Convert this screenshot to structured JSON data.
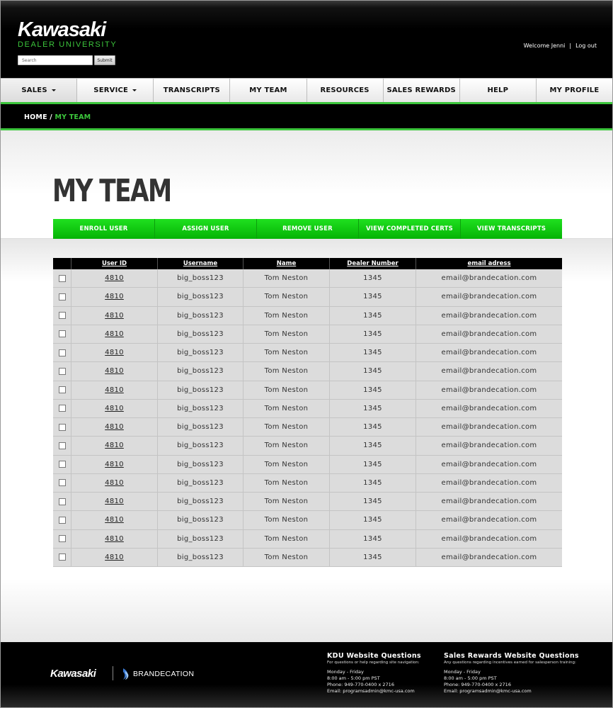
{
  "header": {
    "logo_main": "Kawasaki",
    "logo_sub": "DEALER UNIVERSITY",
    "search_placeholder": "Search",
    "submit_label": "Submit",
    "welcome": "Welcome Jenni",
    "separator": "|",
    "logout": "Log out"
  },
  "nav": {
    "items": [
      {
        "label": "SALES",
        "has_caret": true
      },
      {
        "label": "SERVICE",
        "has_caret": true
      },
      {
        "label": "TRANSCRIPTS"
      },
      {
        "label": "MY TEAM"
      },
      {
        "label": "RESOURCES"
      },
      {
        "label": "SALES REWARDS"
      },
      {
        "label": "HELP"
      },
      {
        "label": "MY PROFILE"
      }
    ]
  },
  "breadcrumb": {
    "home": "HOME",
    "separator": " / ",
    "current": "MY TEAM"
  },
  "page": {
    "title": "MY TEAM"
  },
  "actions": [
    "ENROLL USER",
    "ASSIGN USER",
    "REMOVE USER",
    "VIEW COMPLETED CERTS",
    "VIEW TRANSCRIPTS"
  ],
  "table": {
    "columns": [
      "User ID",
      "Username",
      "Name",
      "Dealer Number",
      "email adress"
    ],
    "rows": [
      {
        "user_id": "4810",
        "username": "big_boss123",
        "name": "Tom Neston",
        "dealer": "1345",
        "email": "email@brandecation.com"
      },
      {
        "user_id": "4810",
        "username": "big_boss123",
        "name": "Tom Neston",
        "dealer": "1345",
        "email": "email@brandecation.com"
      },
      {
        "user_id": "4810",
        "username": "big_boss123",
        "name": "Tom Neston",
        "dealer": "1345",
        "email": "email@brandecation.com"
      },
      {
        "user_id": "4810",
        "username": "big_boss123",
        "name": "Tom Neston",
        "dealer": "1345",
        "email": "email@brandecation.com"
      },
      {
        "user_id": "4810",
        "username": "big_boss123",
        "name": "Tom Neston",
        "dealer": "1345",
        "email": "email@brandecation.com"
      },
      {
        "user_id": "4810",
        "username": "big_boss123",
        "name": "Tom Neston",
        "dealer": "1345",
        "email": "email@brandecation.com"
      },
      {
        "user_id": "4810",
        "username": "big_boss123",
        "name": "Tom Neston",
        "dealer": "1345",
        "email": "email@brandecation.com"
      },
      {
        "user_id": "4810",
        "username": "big_boss123",
        "name": "Tom Neston",
        "dealer": "1345",
        "email": "email@brandecation.com"
      },
      {
        "user_id": "4810",
        "username": "big_boss123",
        "name": "Tom Neston",
        "dealer": "1345",
        "email": "email@brandecation.com"
      },
      {
        "user_id": "4810",
        "username": "big_boss123",
        "name": "Tom Neston",
        "dealer": "1345",
        "email": "email@brandecation.com"
      },
      {
        "user_id": "4810",
        "username": "big_boss123",
        "name": "Tom Neston",
        "dealer": "1345",
        "email": "email@brandecation.com"
      },
      {
        "user_id": "4810",
        "username": "big_boss123",
        "name": "Tom Neston",
        "dealer": "1345",
        "email": "email@brandecation.com"
      },
      {
        "user_id": "4810",
        "username": "big_boss123",
        "name": "Tom Neston",
        "dealer": "1345",
        "email": "email@brandecation.com"
      },
      {
        "user_id": "4810",
        "username": "big_boss123",
        "name": "Tom Neston",
        "dealer": "1345",
        "email": "email@brandecation.com"
      },
      {
        "user_id": "4810",
        "username": "big_boss123",
        "name": "Tom Neston",
        "dealer": "1345",
        "email": "email@brandecation.com"
      },
      {
        "user_id": "4810",
        "username": "big_boss123",
        "name": "Tom Neston",
        "dealer": "1345",
        "email": "email@brandecation.com"
      }
    ]
  },
  "footer": {
    "logo": "Kawasaki",
    "brand": "BRANDECATION",
    "kdu": {
      "title": "KDU Website Questions",
      "sub": "For questions or help regarding site navigation:",
      "lines": [
        "Monday - Friday",
        "8:00 am - 5:00 pm PST",
        "Phone: 949-770-0400 x 2716",
        "Email: programsadmin@kmc-usa.com"
      ]
    },
    "rewards": {
      "title": "Sales Rewards Website Questions",
      "sub": "Any questions regarding incentives earned for salesperson training:",
      "lines": [
        "Monday - Friday",
        "8:00 am - 5:00 pm PST",
        "Phone: 949-770-0400 x 2716",
        "Email: programsadmin@kmc-usa.com"
      ]
    }
  },
  "colors": {
    "accent_green": "#3cc63c",
    "button_green": "#05b305",
    "header_black": "#000000"
  }
}
